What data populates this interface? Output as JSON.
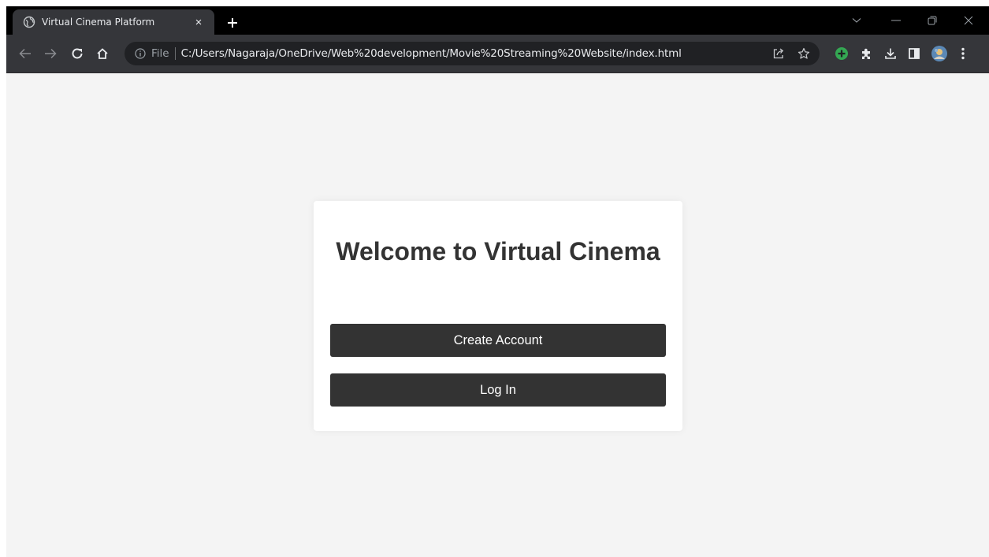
{
  "browser": {
    "tab": {
      "title": "Virtual Cinema Platform",
      "favicon": "globe-icon",
      "close": "×"
    },
    "new_tab": "new-tab-plus-icon",
    "omnibox": {
      "scheme_label": "File",
      "url": "C:/Users/Nagaraja/OneDrive/Web%20development/Movie%20Streaming%20Website/index.html"
    },
    "colors": {
      "tabstrip": "#000000",
      "toolbar": "#35363a",
      "omnibox": "#202124",
      "extension_accent": "#34a853"
    }
  },
  "page": {
    "heading": "Welcome to Virtual Cinema",
    "buttons": {
      "create_account": "Create Account",
      "log_in": "Log In"
    },
    "colors": {
      "background": "#f4f4f4",
      "card": "#ffffff",
      "button": "#333333",
      "heading": "#333333"
    }
  }
}
